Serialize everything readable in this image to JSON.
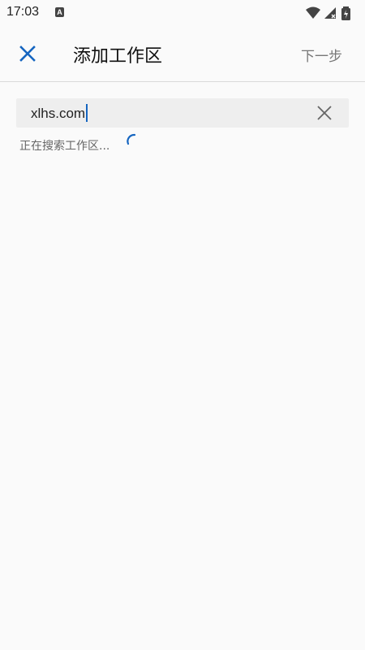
{
  "status_bar": {
    "time": "17:03",
    "notification_letter": "A",
    "icons": [
      "wifi-icon",
      "signal-icon",
      "battery-icon"
    ]
  },
  "app_bar": {
    "title": "添加工作区",
    "next_label": "下一步",
    "close_icon": "close-icon"
  },
  "search": {
    "value": "xlhs.com",
    "clear_icon": "clear-icon"
  },
  "status": {
    "text": "正在搜索工作区..."
  },
  "colors": {
    "accent": "#1565c0",
    "background": "#fafafa",
    "field_background": "#eeeeee"
  }
}
